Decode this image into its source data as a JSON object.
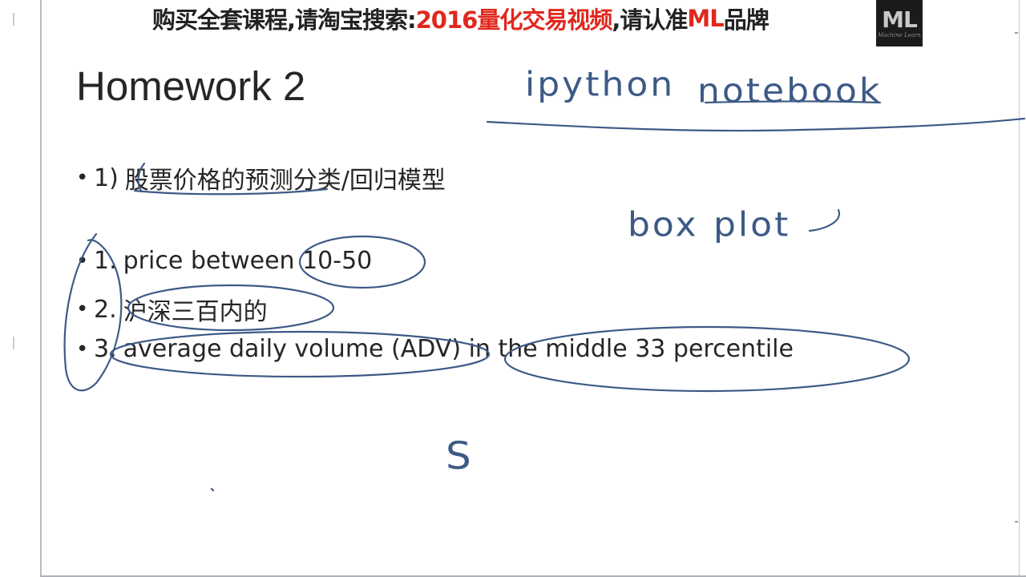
{
  "banner": {
    "part1": "购买全套课程,请淘宝搜索:",
    "part2": "2016量化交易视频",
    "part3": ",请认准",
    "part4": "ML",
    "part5": "品牌"
  },
  "logo": {
    "text": "ML",
    "sub": "Machine Learn"
  },
  "slide": {
    "title": "Homework 2",
    "bullets": [
      {
        "num": "1)",
        "text": "股票价格的预测分类/回归模型"
      },
      {
        "num": "1.",
        "text": "price between 10-50"
      },
      {
        "num": "2.",
        "text": "沪深三百内的"
      },
      {
        "num": "3.",
        "text": "average daily volume (ADV) in the middle 33 percentile"
      }
    ]
  },
  "handwriting": {
    "ipython": "ipython",
    "notebook": "notebook",
    "box": "box",
    "plot": "plot",
    "s": "S"
  },
  "colors": {
    "ink": "#3d5a86",
    "banner_red": "#e0281e",
    "banner_dark": "#222222",
    "text": "#262626"
  }
}
